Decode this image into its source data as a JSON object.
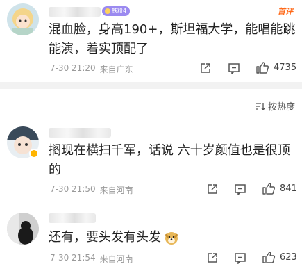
{
  "comments": [
    {
      "badge": "铁粉4",
      "first_tag": "首评",
      "text_line1": "混血脸，身高190+，斯坦福大学，能唱能跳",
      "text_line2": "能演，着实顶配了",
      "time": "7-30 21:20",
      "location": "来自广东",
      "likes": "4735"
    },
    {
      "text_line1": "搁现在横扫千军，话说 六十岁颜值也是很顶",
      "text_line2": "的",
      "time": "7-30 21:50",
      "location": "来自河南",
      "likes": "841"
    },
    {
      "text_line1": "还有，要头发有头发",
      "time": "7-30 21:54",
      "location": "来自河南",
      "likes": "623"
    }
  ],
  "sort": {
    "label": "按热度"
  },
  "colors": {
    "accent": "#ff6a1a",
    "badge": "#9b8af0",
    "divider": "#f2f2f2"
  }
}
